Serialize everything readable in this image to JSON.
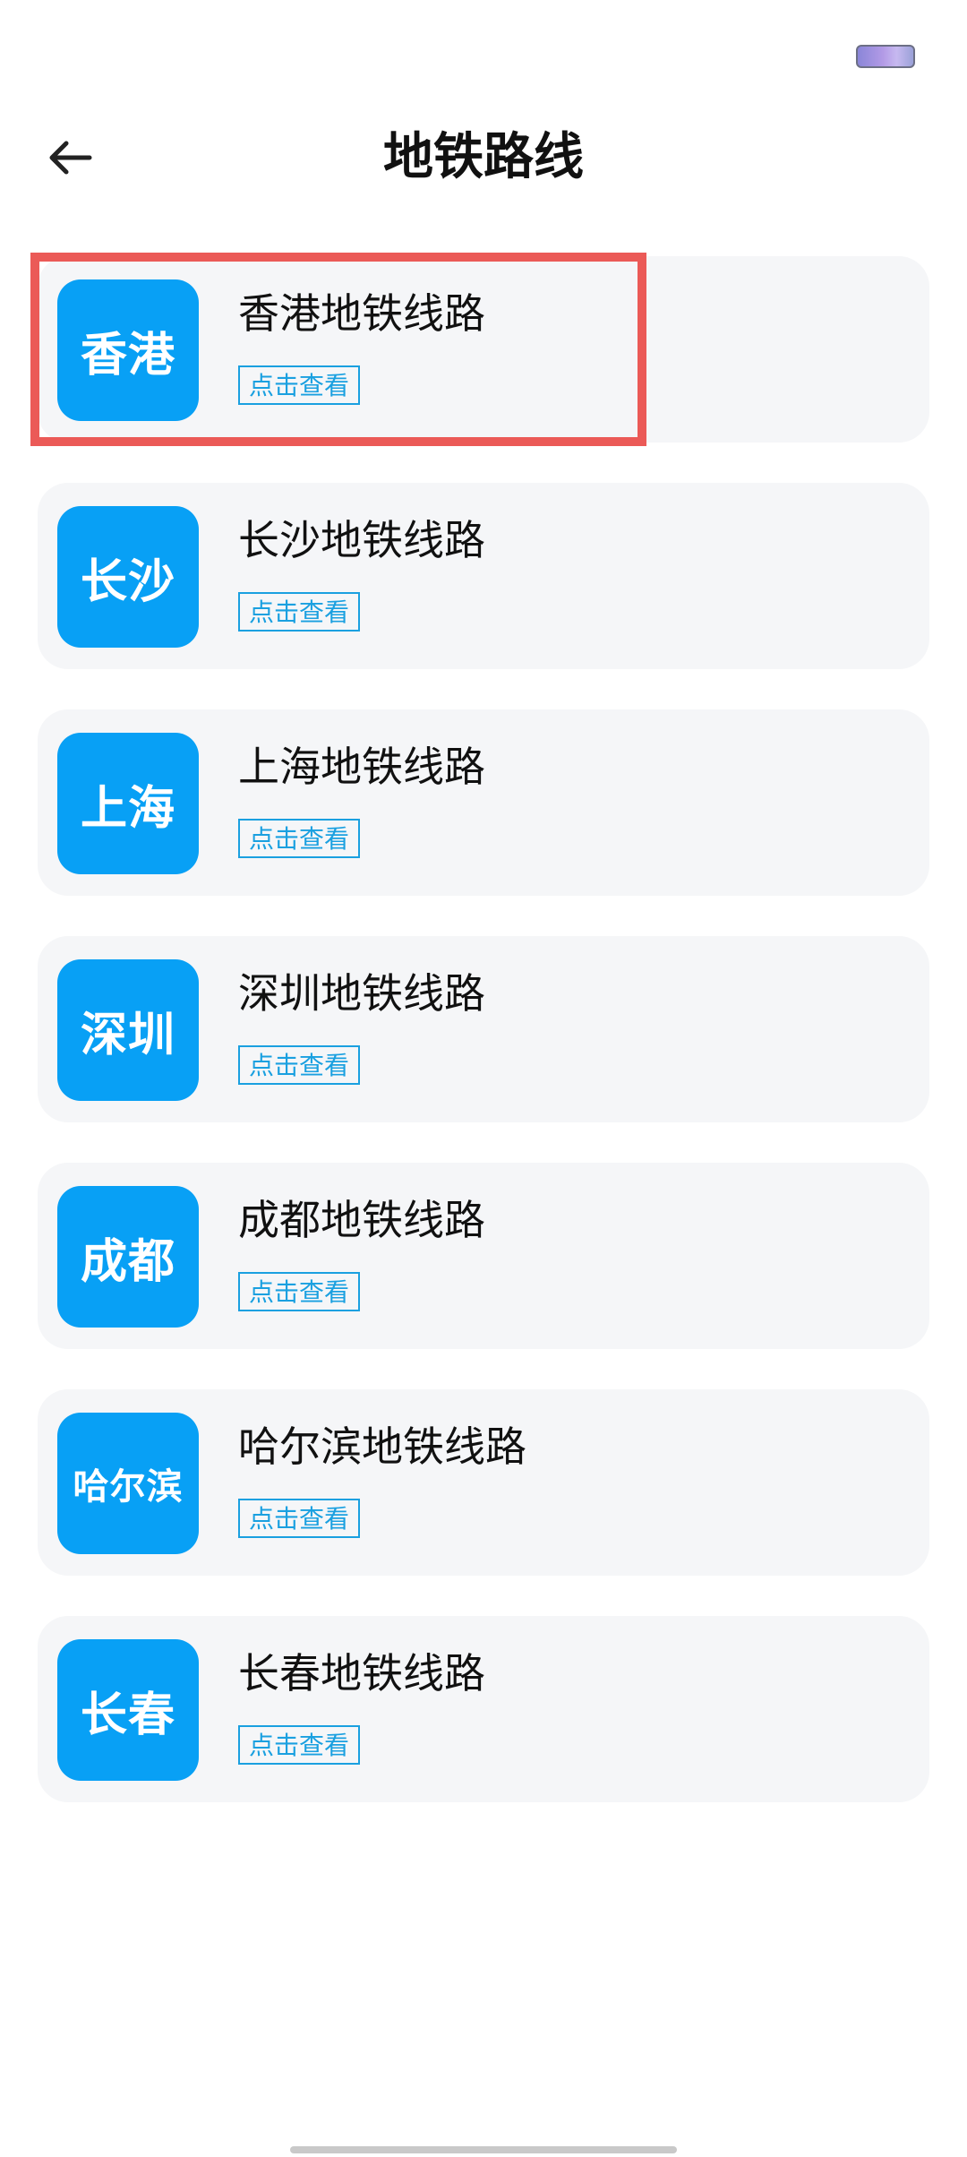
{
  "header": {
    "title": "地铁路线"
  },
  "items": [
    {
      "badge": "香港",
      "title": "香港地铁线路",
      "action": "点击查看"
    },
    {
      "badge": "长沙",
      "title": "长沙地铁线路",
      "action": "点击查看"
    },
    {
      "badge": "上海",
      "title": "上海地铁线路",
      "action": "点击查看"
    },
    {
      "badge": "深圳",
      "title": "深圳地铁线路",
      "action": "点击查看"
    },
    {
      "badge": "成都",
      "title": "成都地铁线路",
      "action": "点击查看"
    },
    {
      "badge": "哈尔滨",
      "title": "哈尔滨地铁线路",
      "action": "点击查看"
    },
    {
      "badge": "长春",
      "title": "长春地铁线路",
      "action": "点击查看"
    }
  ],
  "colors": {
    "badge": "#08a0f5",
    "card_bg": "#f5f6f8",
    "accent": "#1aa0e0",
    "highlight": "#eb5a57"
  },
  "icons": {
    "back": "arrow-left-icon",
    "battery": "battery-icon"
  }
}
